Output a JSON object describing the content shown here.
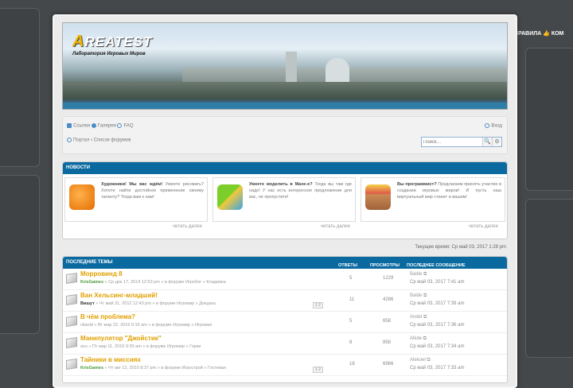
{
  "site": {
    "logo_letter": "A",
    "logo_rest": "REATEST",
    "tagline": "Лаборатория Игровых Миров"
  },
  "side_menu": {
    "rules": "ПРАВИЛА",
    "thumb_icon": "👍",
    "next": "КОМ"
  },
  "nav": {
    "links": [
      "Ссылки",
      "Галерея",
      "FAQ"
    ],
    "login": "Вход",
    "breadcrumb": [
      "Портал",
      "Список форумов"
    ],
    "breadcrumb_sep": "‹",
    "search_placeholder": "Поиск…",
    "search_icon": "🔍",
    "settings_icon": "⚙"
  },
  "news": {
    "title": "НОВОСТИ",
    "items": [
      {
        "bold": "Художники! Мы вас ждём!",
        "text": " Умеете рисовать? Хотите найти достойное применение своему таланту? Тогда вам к нам!",
        "more": "читать далее"
      },
      {
        "bold": "Умеете моделить в Maxe-е?",
        "text": " Тогда вы там где надо! У нас есть интересное предложение для вас, не пропустите!",
        "more": "читать далее"
      },
      {
        "bold": "Вы программист?",
        "text": " Предлагаем принять участие в создании игровых миров! И пусть наш виртуальный мир станет и вашим!",
        "more": "читать далее"
      }
    ]
  },
  "current_time": "Текущее время: Ср май 03, 2017 1:28 pm",
  "topics": {
    "title": "ПОСЛЕДНИЕ ТЕМЫ",
    "col_replies": "ОТВЕТЫ",
    "col_views": "ПРОСМОТРЫ",
    "col_last": "ПОСЛЕДНЕЕ СООБЩЕНИЕ",
    "rows": [
      {
        "title": "Морровинд 8",
        "author": "KrisGames",
        "meta": " » Ср дек 17, 2014 12:53 pm » в форуме Игробог » Кладовка",
        "pages": "",
        "replies": "5",
        "views": "1229",
        "last_user": "Balde ⧉",
        "last_date": "Ср май 03, 2017 7:41 am",
        "green": true
      },
      {
        "title": "Ван Хельсинг-младший!",
        "author": "Вишут",
        "meta": " » Чт май 31, 2012 12:43 pm » в форуме Игромир » Докурка",
        "pages": "1 2",
        "replies": "11",
        "views": "4286",
        "last_user": "Balde ⧉",
        "last_date": "Ср май 03, 2017 7:39 am",
        "green": false
      },
      {
        "title": "В чём проблема?",
        "author": "",
        "meta": "vitaold » Вт мар 22, 2016 9:16 am » в форуме Игромир » Игровая",
        "pages": "",
        "replies": "5",
        "views": "658",
        "last_user": "Andel ⧉",
        "last_date": "Ср май 03, 2017 7:36 am",
        "green": false
      },
      {
        "title": "Манипулятор \"Джойстик\"",
        "author": "",
        "meta": "avu » Пт мар 11, 2016 9:30 am » в форуме Игромир » Горки",
        "pages": "",
        "replies": "8",
        "views": "858",
        "last_user": "Alkde ⧉",
        "last_date": "Ср май 03, 2017 7:34 am",
        "green": false
      },
      {
        "title": "Тайники в миссиях",
        "author": "KrisGames",
        "meta": " » Чт авг 12, 2010 8:37 pm » в форуме Игрострой » Гостевая",
        "pages": "1 2",
        "replies": "18",
        "views": "6966",
        "last_user": "Alekoel ⧉",
        "last_date": "Ср май 03, 2017 7:33 am",
        "green": true
      }
    ]
  }
}
